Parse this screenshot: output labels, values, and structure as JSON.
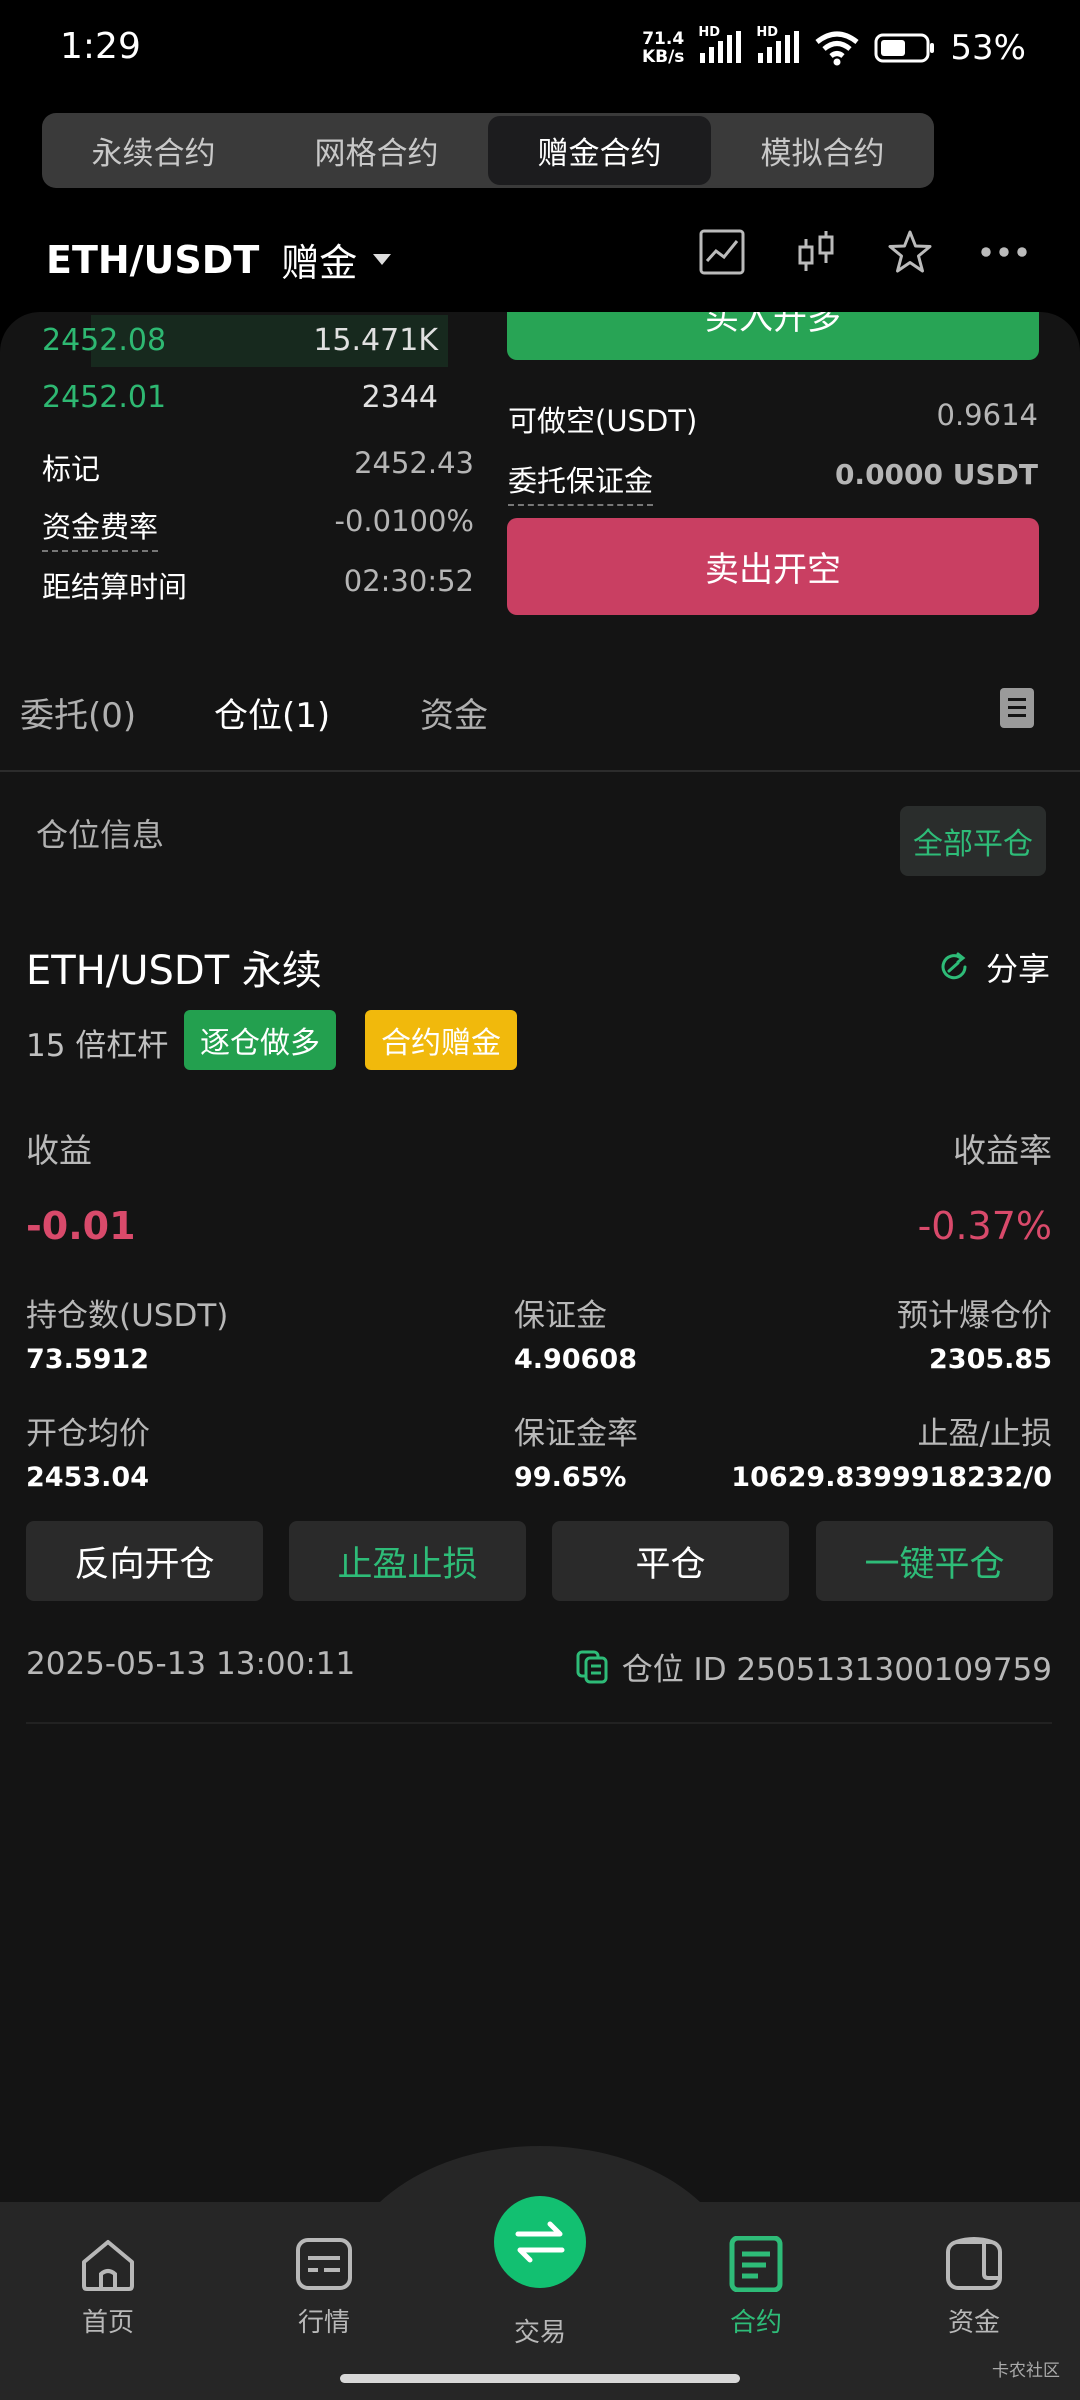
{
  "status_bar": {
    "time": "1:29",
    "net_speed_value": "71.4",
    "net_speed_unit": "KB/s",
    "hd1": "HD",
    "hd2": "HD",
    "battery": "53%"
  },
  "top_tabs": [
    {
      "label": "永续合约",
      "active": false
    },
    {
      "label": "网格合约",
      "active": false
    },
    {
      "label": "赠金合约",
      "active": true
    },
    {
      "label": "模拟合约",
      "active": false
    }
  ],
  "header": {
    "pair": "ETH/USDT",
    "mode": "赠金"
  },
  "order_book": [
    {
      "price": "2452.08",
      "qty": "15.471K",
      "depth": 0.85
    },
    {
      "price": "2452.01",
      "qty": "2344",
      "depth": 0
    }
  ],
  "market_info": {
    "mark_label": "标记",
    "mark_value": "2452.43",
    "funding_label": "资金费率",
    "funding_value": "-0.0100%",
    "settle_label": "距结算时间",
    "settle_value": "02:30:52"
  },
  "order_panel": {
    "buy_label": "买入开多",
    "short_avail_label": "可做空(USDT)",
    "short_avail_value": "0.9614",
    "order_margin_label": "委托保证金",
    "order_margin_value": "0.0000 USDT",
    "sell_label": "卖出开空"
  },
  "section_tabs": [
    {
      "label": "委托(0)",
      "active": false
    },
    {
      "label": "仓位(1)",
      "active": true
    },
    {
      "label": "资金",
      "active": false
    }
  ],
  "position": {
    "info_label": "仓位信息",
    "close_all": "全部平仓",
    "title": "ETH/USDT 永续",
    "share": "分享",
    "leverage": "15 倍杠杆",
    "tag_side": "逐仓做多",
    "tag_bonus": "合约赠金",
    "profit_label": "收益",
    "profit_value": "-0.01",
    "rate_label": "收益率",
    "rate_value": "-0.37%",
    "size_label": "持仓数(USDT)",
    "size_value": "73.5912",
    "margin_label": "保证金",
    "margin_value": "4.90608",
    "liq_label": "预计爆仓价",
    "liq_value": "2305.85",
    "entry_label": "开仓均价",
    "entry_value": "2453.04",
    "margin_rate_label": "保证金率",
    "margin_rate_value": "99.65%",
    "tpsl_label": "止盈/止损",
    "tpsl_value": "10629.8399918232/0",
    "actions": [
      "反向开仓",
      "止盈止损",
      "平仓",
      "一键平仓"
    ],
    "date": "2025-05-13 13:00:11",
    "id_text": "仓位 ID 2505131300109759"
  },
  "bottom_nav": [
    {
      "label": "首页",
      "icon": "home-icon"
    },
    {
      "label": "行情",
      "icon": "market-icon"
    },
    {
      "label": "交易",
      "icon": "swap-icon"
    },
    {
      "label": "合约",
      "icon": "contract-icon",
      "active": true
    },
    {
      "label": "资金",
      "icon": "wallet-icon"
    }
  ],
  "watermark": "卡农社区",
  "colors": {
    "green": "#2ebc78",
    "red": "#c93f62",
    "yellow": "#f1b90c",
    "panel": "#141414"
  }
}
